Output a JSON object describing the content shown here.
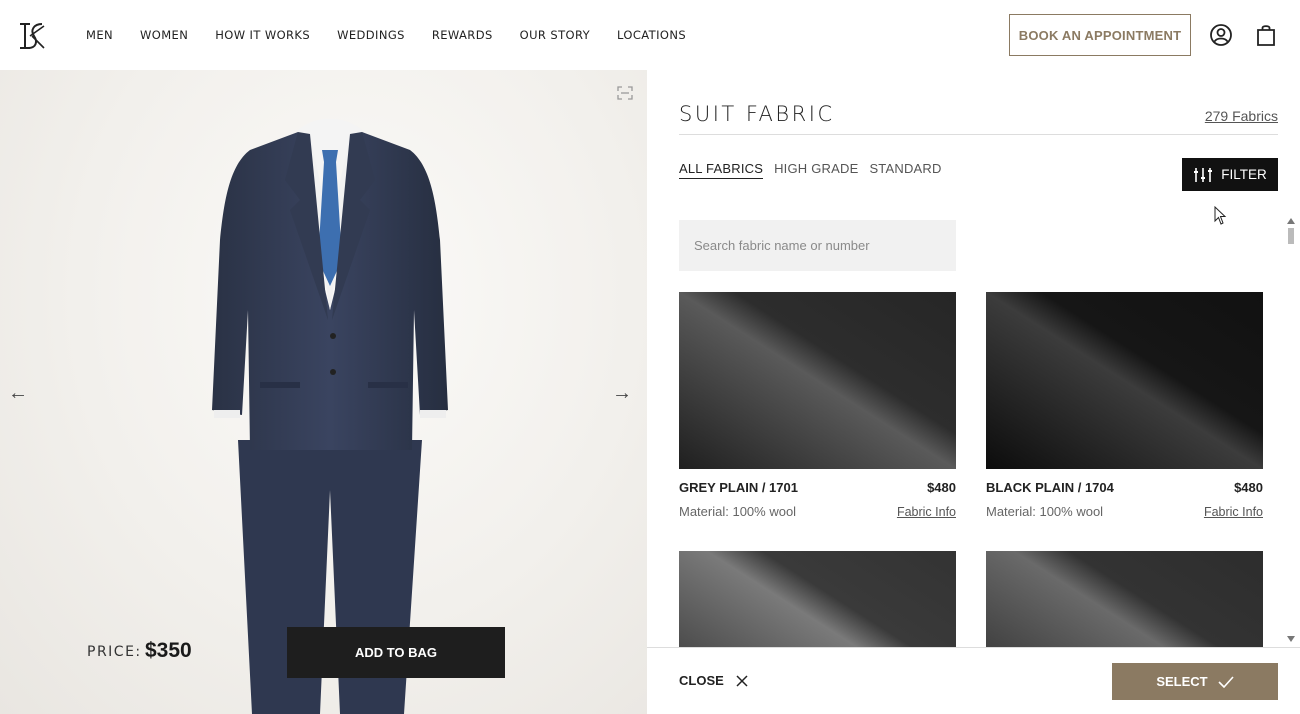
{
  "header": {
    "logo_icon": "monogram-logo-icon",
    "nav": [
      "MEN",
      "WOMEN",
      "HOW IT WORKS",
      "WEDDINGS",
      "REWARDS",
      "OUR STORY",
      "LOCATIONS"
    ],
    "book_label": "BOOK AN APPOINTMENT",
    "account_icon": "user-circle-icon",
    "bag_icon": "shopping-bag-icon",
    "accent_color": "#8b7a62"
  },
  "preview": {
    "price_label": "PRICE:",
    "price_value": "$350",
    "add_to_bag": "ADD TO BAG",
    "prev_arrow": "←",
    "next_arrow": "→"
  },
  "panel": {
    "title": "SUIT FABRIC",
    "count": "279 Fabrics",
    "tabs": [
      "ALL FABRICS",
      "HIGH GRADE",
      "STANDARD"
    ],
    "active_tab": "ALL FABRICS",
    "filter_label": "FILTER",
    "search_placeholder": "Search fabric name or number",
    "fabrics": [
      {
        "name": "GREY PLAIN / 1701",
        "price": "$480",
        "material": "Material: 100% wool",
        "info": "Fabric Info",
        "color": "#2b2b2b"
      },
      {
        "name": "BLACK PLAIN / 1704",
        "price": "$480",
        "material": "Material: 100% wool",
        "info": "Fabric Info",
        "color": "#111111"
      },
      {
        "name": "",
        "price": "",
        "material": "",
        "info": "",
        "color": "#3a3a3a"
      },
      {
        "name": "",
        "price": "",
        "material": "",
        "info": "",
        "color": "#2e2e2e"
      }
    ],
    "close_label": "CLOSE",
    "select_label": "SELECT"
  }
}
